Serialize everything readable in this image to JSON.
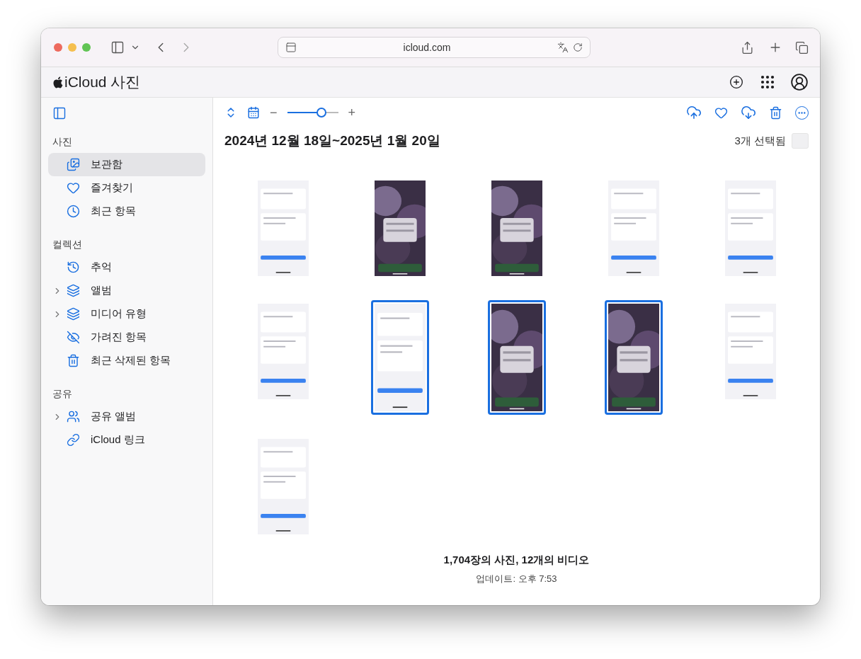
{
  "browser": {
    "address": "icloud.com"
  },
  "app": {
    "title": "iCloud 사진"
  },
  "sidebar": {
    "sections": [
      {
        "title": "사진",
        "items": [
          {
            "label": "보관함",
            "kind": "library",
            "expandable": false,
            "selected": true
          },
          {
            "label": "즐겨찾기",
            "kind": "heart",
            "expandable": false,
            "selected": false
          },
          {
            "label": "최근 항목",
            "kind": "clock",
            "expandable": false,
            "selected": false
          }
        ]
      },
      {
        "title": "컬렉션",
        "items": [
          {
            "label": "추억",
            "kind": "memories",
            "expandable": false,
            "selected": false
          },
          {
            "label": "앨범",
            "kind": "stack",
            "expandable": true,
            "selected": false
          },
          {
            "label": "미디어 유형",
            "kind": "stack",
            "expandable": true,
            "selected": false
          },
          {
            "label": "가려진 항목",
            "kind": "hidden",
            "expandable": false,
            "selected": false
          },
          {
            "label": "최근 삭제된 항목",
            "kind": "trash",
            "expandable": false,
            "selected": false
          }
        ]
      },
      {
        "title": "공유",
        "items": [
          {
            "label": "공유 앨범",
            "kind": "shared",
            "expandable": true,
            "selected": false
          },
          {
            "label": "iCloud 링크",
            "kind": "link",
            "expandable": false,
            "selected": false
          }
        ]
      }
    ]
  },
  "toolbar": {
    "zoom": {
      "minus": "−",
      "plus": "+",
      "level": 0.68
    }
  },
  "header": {
    "date_range": "2024년 12월 18일~2025년 1월 20일",
    "selection": "3개 선택됨"
  },
  "photos": [
    {
      "kind": "light",
      "selected": false
    },
    {
      "kind": "dark",
      "selected": false
    },
    {
      "kind": "dark",
      "selected": false
    },
    {
      "kind": "light",
      "selected": false
    },
    {
      "kind": "light",
      "selected": false
    },
    {
      "kind": "light",
      "selected": false
    },
    {
      "kind": "light",
      "selected": true
    },
    {
      "kind": "dark",
      "selected": true
    },
    {
      "kind": "dark",
      "selected": true
    },
    {
      "kind": "light",
      "selected": false
    },
    {
      "kind": "light",
      "selected": false
    }
  ],
  "footer": {
    "count": "1,704장의 사진, 12개의 비디오",
    "updated": "업데이트: 오후 7:53"
  }
}
